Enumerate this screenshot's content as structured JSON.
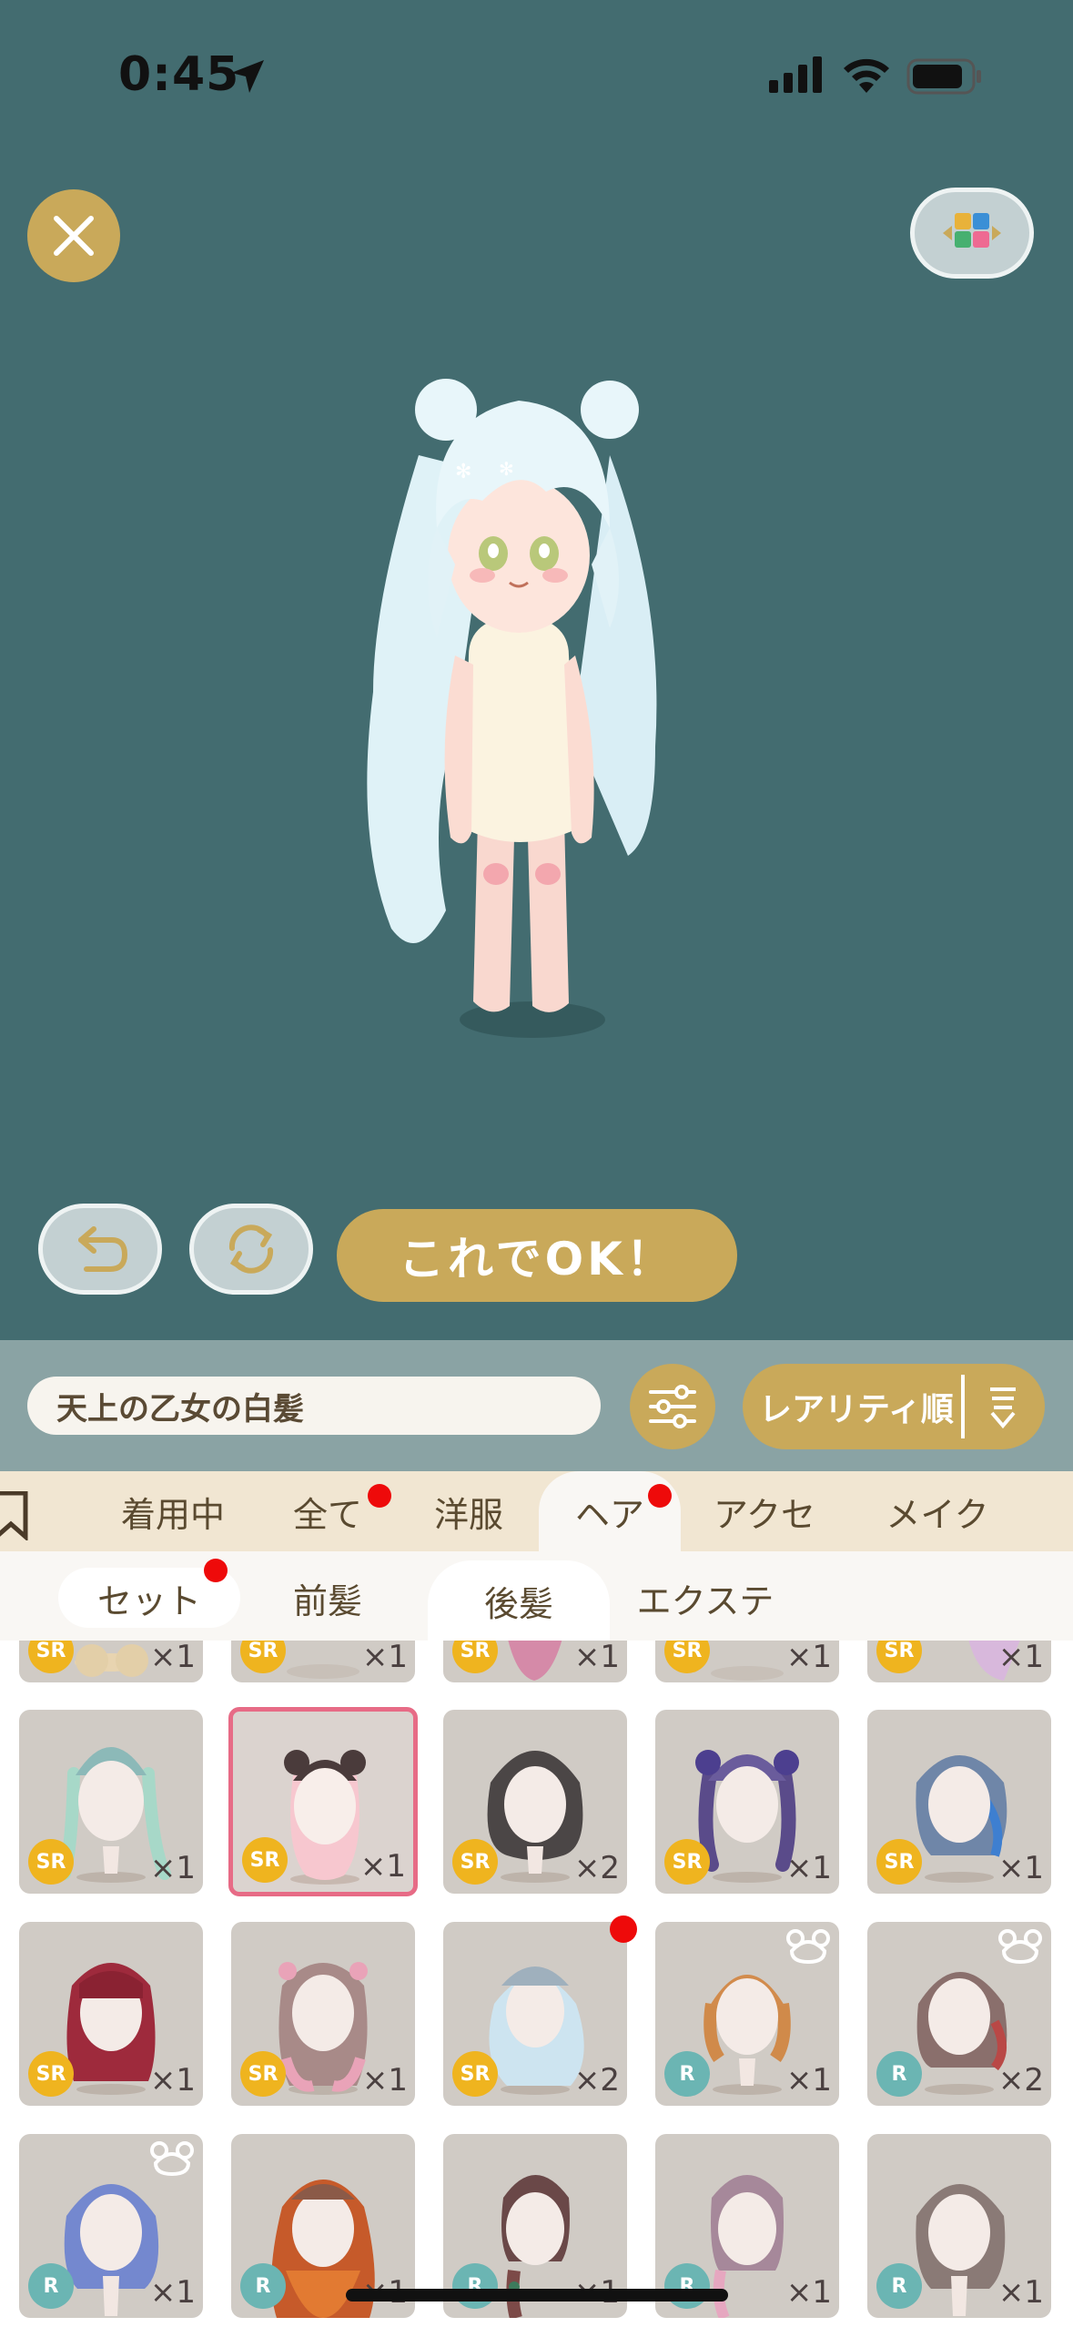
{
  "status": {
    "time": "0:45"
  },
  "stage": {
    "ok_label": "これでOK！"
  },
  "search": {
    "value": "天上の乙女の白髪"
  },
  "sort": {
    "label": "レアリティ順"
  },
  "category_tabs": [
    "着用中",
    "全て",
    "洋服",
    "ヘア",
    "アクセ",
    "メイク"
  ],
  "sub_tabs": [
    "セット",
    "前髪",
    "後髪",
    "エクステ"
  ],
  "items_row0": [
    {
      "rarity": "SR",
      "qty": "×1"
    },
    {
      "rarity": "SR",
      "qty": "×1"
    },
    {
      "rarity": "SR",
      "qty": "×1"
    },
    {
      "rarity": "SR",
      "qty": "×1"
    },
    {
      "rarity": "SR",
      "qty": "×1"
    }
  ],
  "items_row1": [
    {
      "rarity": "SR",
      "qty": "×1"
    },
    {
      "rarity": "SR",
      "qty": "×1"
    },
    {
      "rarity": "SR",
      "qty": "×2"
    },
    {
      "rarity": "SR",
      "qty": "×1"
    },
    {
      "rarity": "SR",
      "qty": "×1"
    }
  ],
  "items_row2": [
    {
      "rarity": "SR",
      "qty": "×1"
    },
    {
      "rarity": "SR",
      "qty": "×1"
    },
    {
      "rarity": "SR",
      "qty": "×2"
    },
    {
      "rarity": "R",
      "qty": "×1"
    },
    {
      "rarity": "R",
      "qty": "×2"
    }
  ],
  "items_row3": [
    {
      "rarity": "R",
      "qty": "×1"
    },
    {
      "rarity": "R",
      "qty": "×1"
    },
    {
      "rarity": "R",
      "qty": "×1"
    },
    {
      "rarity": "R",
      "qty": "×1"
    },
    {
      "rarity": "R",
      "qty": "×1"
    }
  ],
  "colors": {
    "accent": "#c9a95a",
    "stage_bg": "#436c70",
    "selected_border": "#e76b86",
    "notification": "#ee0a0a"
  }
}
